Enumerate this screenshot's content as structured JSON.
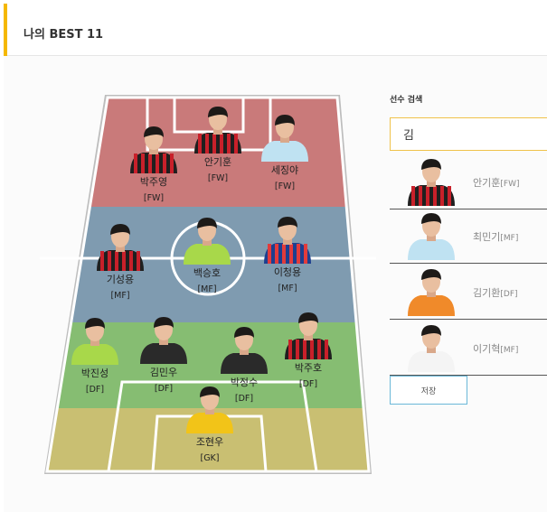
{
  "header": {
    "title": "나의 BEST 11"
  },
  "field": {
    "players": [
      {
        "name": "박주영",
        "pos": "[FW]",
        "kit": "stripe-red"
      },
      {
        "name": "안기훈",
        "pos": "[FW]",
        "kit": "stripe-red"
      },
      {
        "name": "세징야",
        "pos": "[FW]",
        "kit": "sky"
      },
      {
        "name": "기성용",
        "pos": "[MF]",
        "kit": "stripe-red"
      },
      {
        "name": "백승호",
        "pos": "[MF]",
        "kit": "lime"
      },
      {
        "name": "이청용",
        "pos": "[MF]",
        "kit": "stripe-blue"
      },
      {
        "name": "박진성",
        "pos": "[DF]",
        "kit": "lime"
      },
      {
        "name": "김민우",
        "pos": "[DF]",
        "kit": "black"
      },
      {
        "name": "박정수",
        "pos": "[DF]",
        "kit": "black"
      },
      {
        "name": "박주호",
        "pos": "[DF]",
        "kit": "stripe-red"
      },
      {
        "name": "조현우",
        "pos": "[GK]",
        "kit": "yellow"
      }
    ]
  },
  "search": {
    "label": "선수 검색",
    "value": "김"
  },
  "results": [
    {
      "name": "안기훈",
      "pos": "[FW]",
      "kit": "stripe-red"
    },
    {
      "name": "최민기",
      "pos": "[MF]",
      "kit": "sky"
    },
    {
      "name": "김기환",
      "pos": "[DF]",
      "kit": "orange"
    },
    {
      "name": "이기혁",
      "pos": "[MF]",
      "kit": "white"
    }
  ],
  "save_label": "저장",
  "colors": {
    "accent": "#f5b800",
    "zone_fw": "#c97a7a",
    "zone_mf": "#7f9bb0",
    "zone_df": "#86bd72",
    "zone_gk": "#c9bf72",
    "save_border": "#6ab8d8"
  }
}
